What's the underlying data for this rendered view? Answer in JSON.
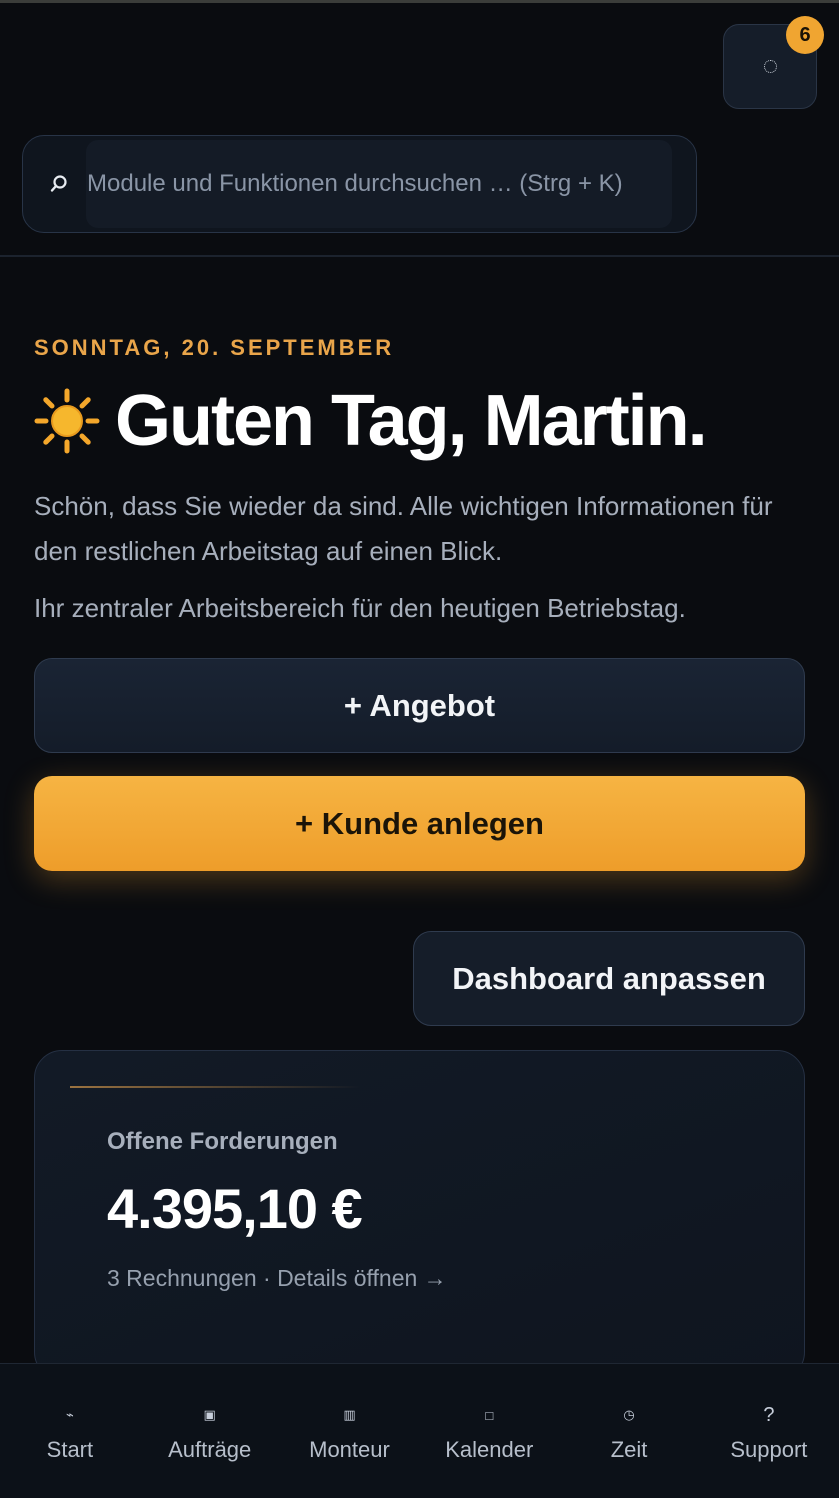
{
  "header": {
    "notifications": {
      "icon": "loading-ring-icon",
      "badge_count": "6",
      "badge_color": "#f0a531"
    },
    "search": {
      "icon": "search-icon",
      "placeholder": "Module und Funktionen durchsuchen … (Strg + K)"
    }
  },
  "greeting": {
    "date": "SONNTAG, 20. SEPTEMBER",
    "icon": "sun-icon",
    "title": "Guten Tag, Martin.",
    "subtitle": "Schön, dass Sie wieder da sind. Alle wichtigen Informationen für den restlichen Arbeitstag auf einen Blick.",
    "description": "Ihr zentraler Arbeitsbereich für den heutigen Betriebstag."
  },
  "actions": {
    "offer_label": "+ Angebot",
    "customer_label": "+ Kunde anlegen",
    "dashboard_label": "Dashboard anpassen"
  },
  "card": {
    "title": "Offene Forderungen",
    "amount": "4.395,10 €",
    "meta": "3 Rechnungen · Details öffnen →"
  },
  "bottom_nav": {
    "items": [
      {
        "label": "Start",
        "icon": "activity-icon",
        "glyph": "⌁"
      },
      {
        "label": "Aufträge",
        "icon": "orders-icon",
        "glyph": "▣"
      },
      {
        "label": "Monteur",
        "icon": "technician-icon",
        "glyph": "▥"
      },
      {
        "label": "Kalender",
        "icon": "calendar-icon",
        "glyph": "□"
      },
      {
        "label": "Zeit",
        "icon": "clock-icon",
        "glyph": "◷"
      },
      {
        "label": "Support",
        "icon": "help-icon",
        "glyph": "?"
      }
    ]
  },
  "colors": {
    "accent": "#f0a531",
    "background": "#0a0c10",
    "card": "#121a26"
  }
}
